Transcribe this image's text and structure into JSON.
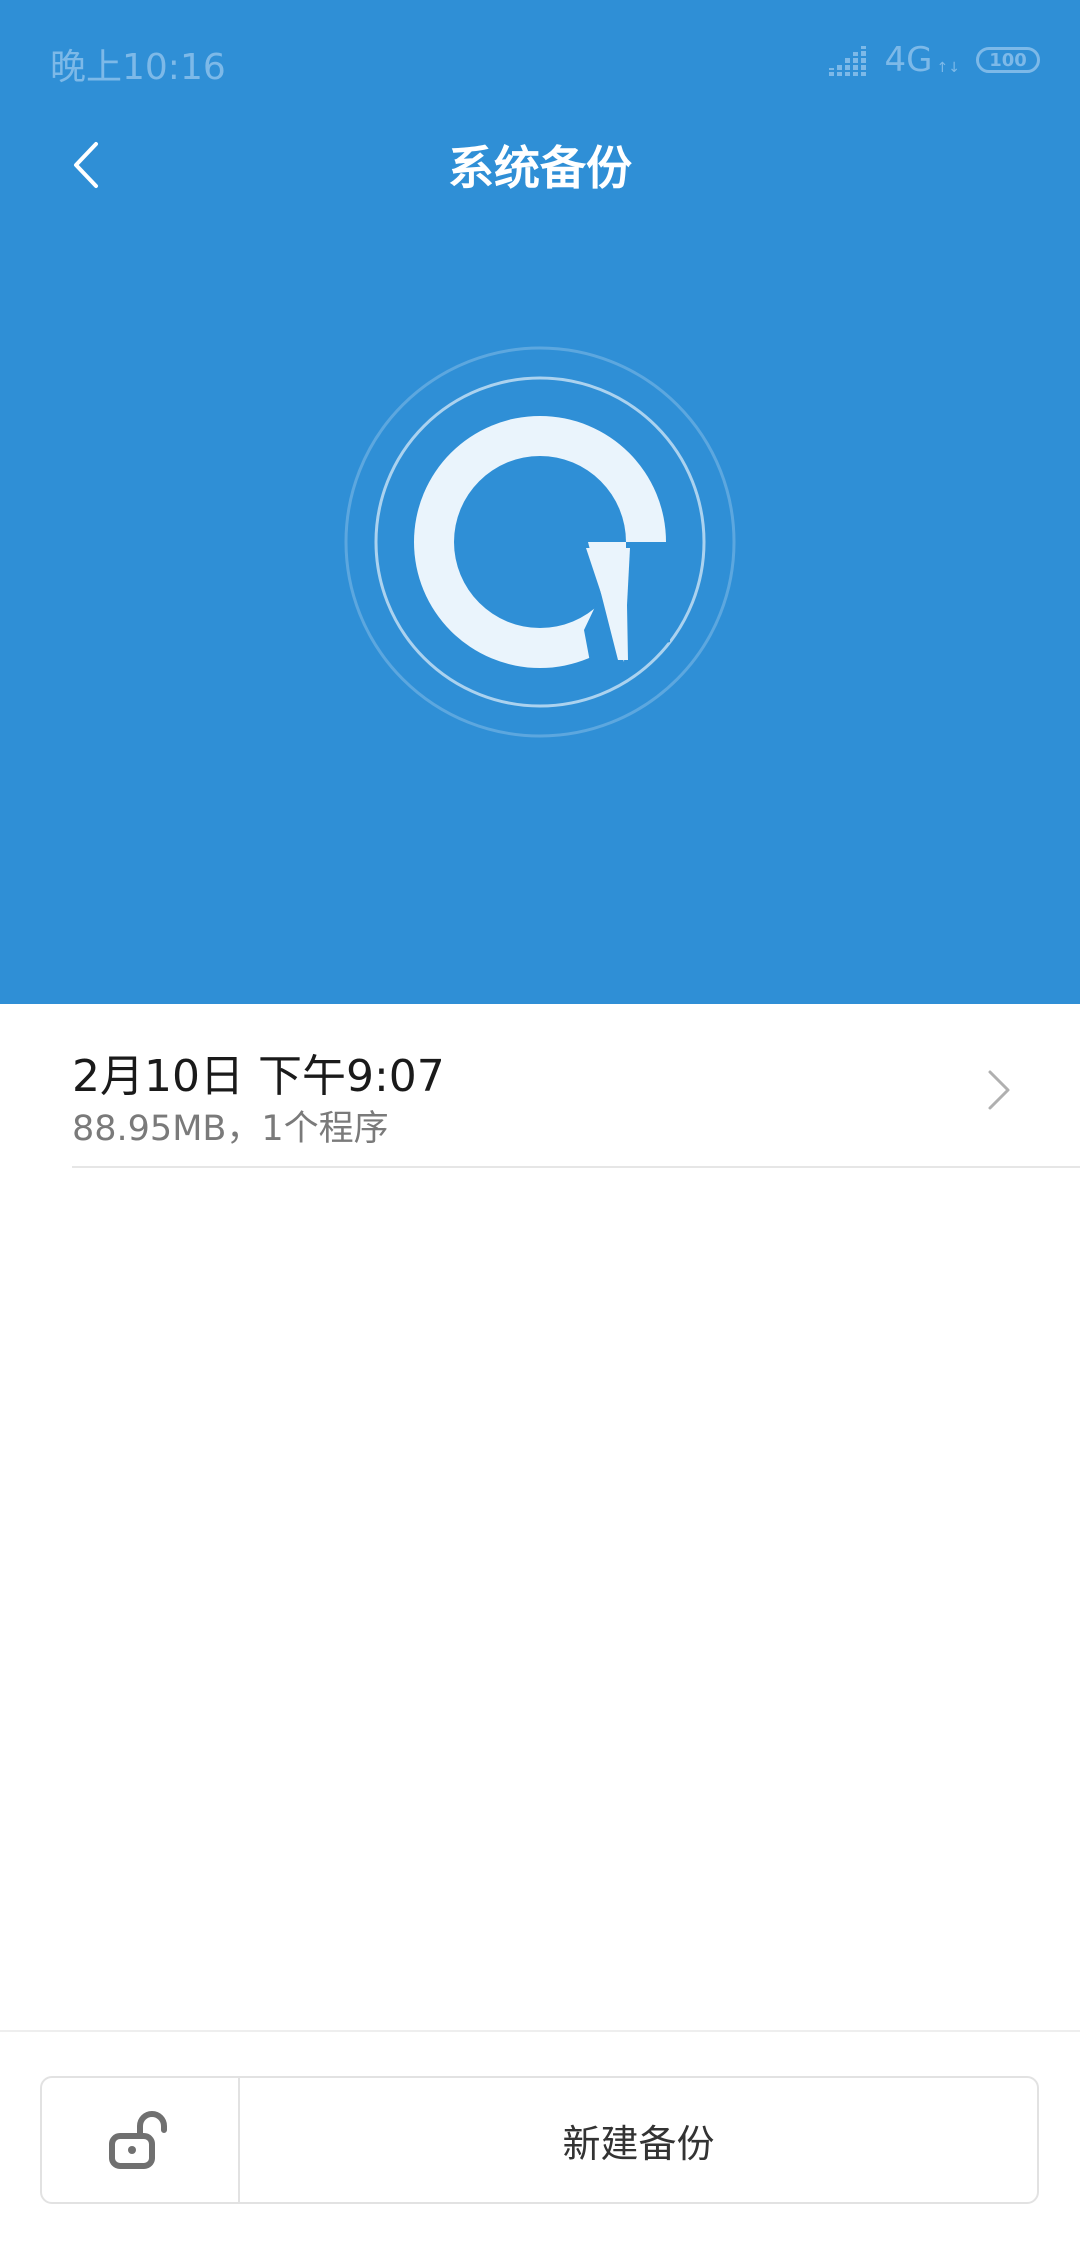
{
  "status_bar": {
    "time": "晚上10:16",
    "network": "4G",
    "battery": "100"
  },
  "header": {
    "title": "系统备份"
  },
  "backup_list": [
    {
      "title": "2月10日 下午9:07",
      "subtitle": "88.95MB，1个程序"
    }
  ],
  "footer": {
    "new_backup_label": "新建备份"
  },
  "colors": {
    "brand_blue": "#2F8FD6",
    "status_text": "#7DB9E8",
    "logo_fill": "#EAF4FC"
  },
  "icons": {
    "back": "chevron-left-icon",
    "item_arrow": "chevron-right-icon",
    "lock": "unlocked-padlock-icon",
    "logo": "backup-logo-icon"
  }
}
